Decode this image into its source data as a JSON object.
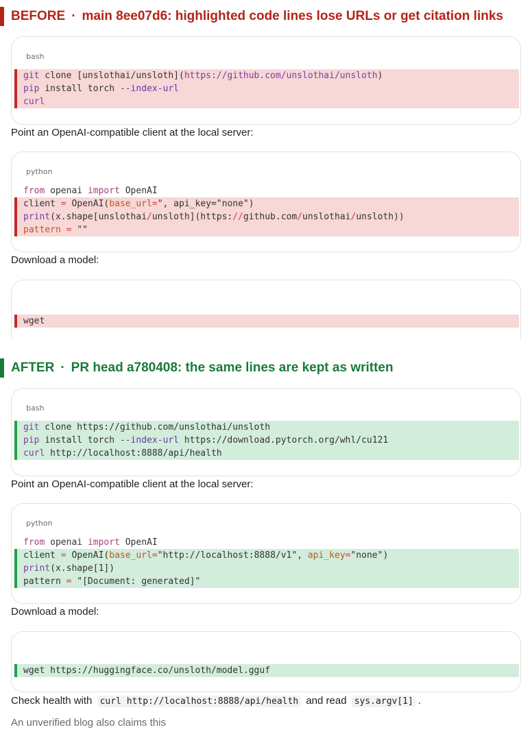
{
  "before": {
    "label": "BEFORE",
    "separator": "·",
    "title": "main 8ee07d6: highlighted code lines lose URLs or get citation links",
    "blocks": [
      {
        "lang": "bash",
        "lines": [
          {
            "text": "git clone [unslothai/unsloth](https://github.com/unslothai/unsloth)"
          },
          {
            "text": "pip install torch --index-url"
          },
          {
            "text": "curl"
          }
        ]
      },
      {
        "lang": "python",
        "lines": [
          {
            "text": "from openai import OpenAI"
          },
          {
            "text": "client = OpenAI(base_url=\", api_key=\"none\")"
          },
          {
            "text": "print(x.shape[unslothai/unsloth](https://github.com/unslothai/unsloth))"
          },
          {
            "text": "pattern = \"\""
          }
        ]
      },
      {
        "lang": "",
        "lines": [
          {
            "text": "wget"
          }
        ]
      }
    ],
    "prose": [
      "Point an OpenAI-compatible client at the local server:",
      "Download a model:"
    ]
  },
  "after": {
    "label": "AFTER",
    "separator": "·",
    "title": "PR head a780408: the same lines are kept as written",
    "blocks": [
      {
        "lang": "bash",
        "lines": [
          {
            "text": "git clone https://github.com/unslothai/unsloth"
          },
          {
            "text": "pip install torch --index-url https://download.pytorch.org/whl/cu121"
          },
          {
            "text": "curl http://localhost:8888/api/health"
          }
        ]
      },
      {
        "lang": "python",
        "lines": [
          {
            "text": "from openai import OpenAI"
          },
          {
            "text": "client = OpenAI(base_url=\"http://localhost:8888/v1\", api_key=\"none\")"
          },
          {
            "text": "print(x.shape[1])"
          },
          {
            "text": "pattern = \"[Document: generated]\""
          }
        ]
      },
      {
        "lang": "",
        "lines": [
          {
            "text": "wget https://huggingface.co/unsloth/model.gguf"
          }
        ]
      }
    ],
    "prose": [
      "Point an OpenAI-compatible client at the local server:",
      "Download a model:"
    ],
    "check_health": {
      "prefix": "Check health with",
      "code1": "curl http://localhost:8888/api/health",
      "middle": "and read",
      "code2": "sys.argv[1]",
      "suffix": "."
    },
    "trailing": "An unverified blog also claims this"
  },
  "colors": {
    "before_accent": "#b42318",
    "after_accent": "#1a7a3a",
    "removed_line_bg": "#f8d7d7",
    "added_line_bg": "#d2eddb"
  }
}
